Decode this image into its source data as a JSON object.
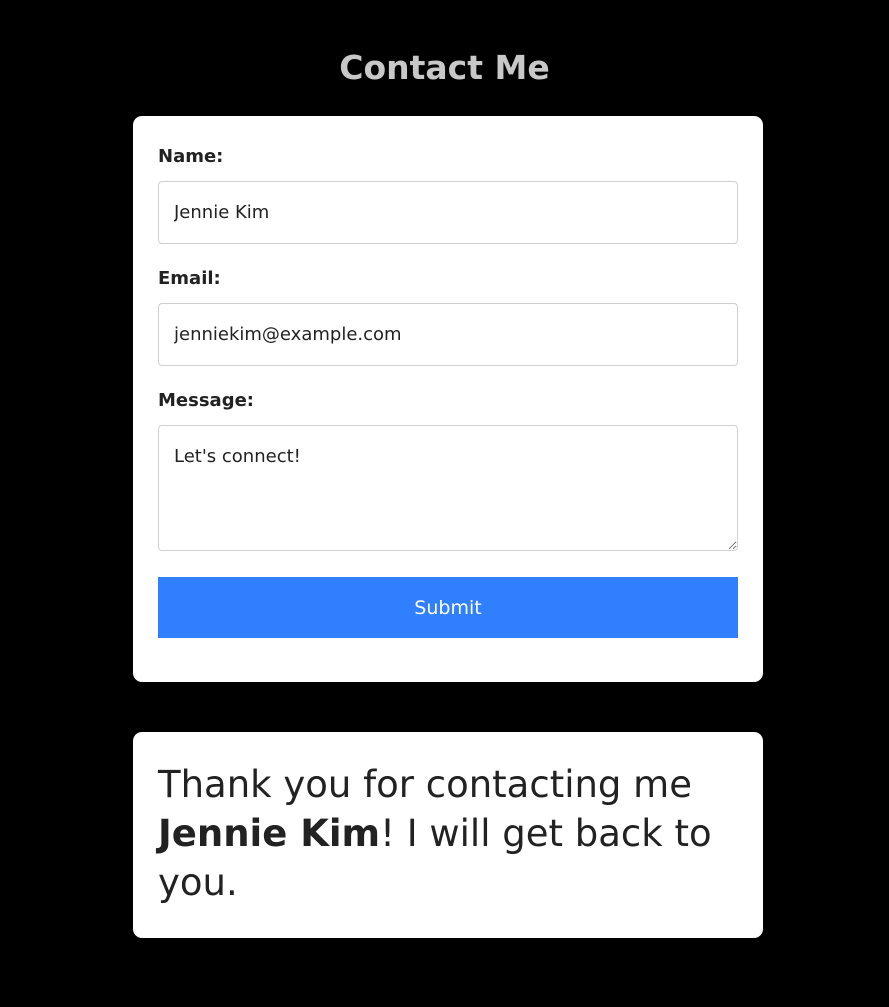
{
  "page": {
    "title": "Contact Me"
  },
  "form": {
    "name_label": "Name:",
    "name_value": "Jennie Kim",
    "email_label": "Email:",
    "email_value": "jenniekim@example.com",
    "message_label": "Message:",
    "message_value": "Let's connect!",
    "submit_label": "Submit"
  },
  "confirmation": {
    "prefix": "Thank you for contacting me ",
    "name": "Jennie Kim",
    "suffix": "! I will get back to you."
  },
  "colors": {
    "background": "#000000",
    "card": "#ffffff",
    "accent": "#2f7ffe",
    "title": "#c8c8c8",
    "text": "#222222"
  }
}
